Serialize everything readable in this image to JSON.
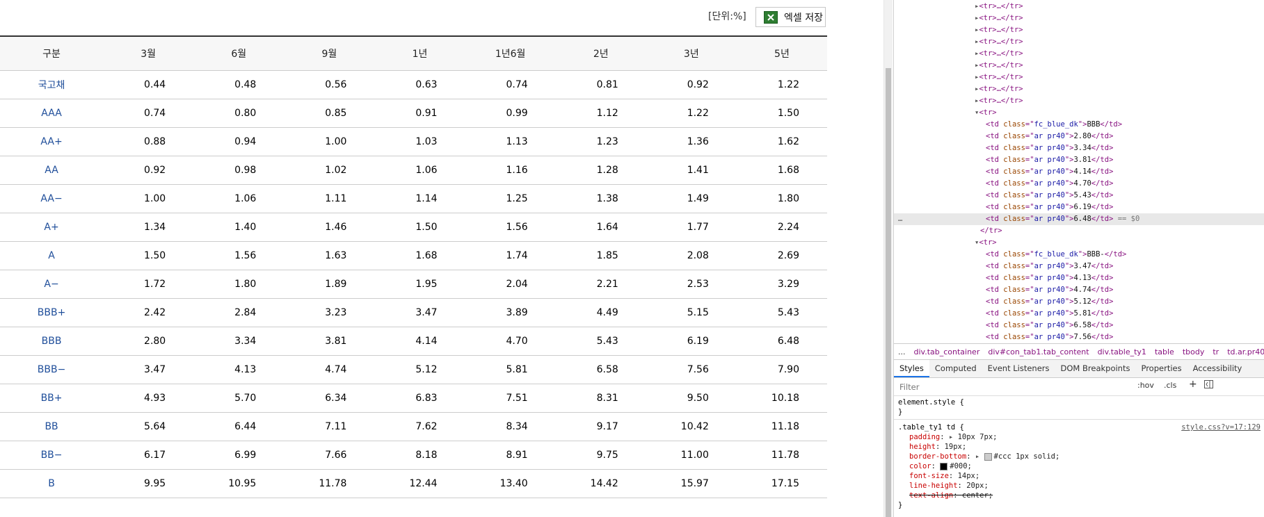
{
  "page": {
    "unit_label": "[단위:%]",
    "excel_button": "엑셀 저장",
    "table": {
      "headers": [
        "구분",
        "3월",
        "6월",
        "9월",
        "1년",
        "1년6월",
        "2년",
        "3년",
        "5년"
      ],
      "rows": [
        {
          "grade": "국고채",
          "values": [
            "0.44",
            "0.48",
            "0.56",
            "0.63",
            "0.74",
            "0.81",
            "0.92",
            "1.22"
          ]
        },
        {
          "grade": "AAA",
          "values": [
            "0.74",
            "0.80",
            "0.85",
            "0.91",
            "0.99",
            "1.12",
            "1.22",
            "1.50"
          ]
        },
        {
          "grade": "AA+",
          "values": [
            "0.88",
            "0.94",
            "1.00",
            "1.03",
            "1.13",
            "1.23",
            "1.36",
            "1.62"
          ]
        },
        {
          "grade": "AA",
          "values": [
            "0.92",
            "0.98",
            "1.02",
            "1.06",
            "1.16",
            "1.28",
            "1.41",
            "1.68"
          ]
        },
        {
          "grade": "AA−",
          "values": [
            "1.00",
            "1.06",
            "1.11",
            "1.14",
            "1.25",
            "1.38",
            "1.49",
            "1.80"
          ]
        },
        {
          "grade": "A+",
          "values": [
            "1.34",
            "1.40",
            "1.46",
            "1.50",
            "1.56",
            "1.64",
            "1.77",
            "2.24"
          ]
        },
        {
          "grade": "A",
          "values": [
            "1.50",
            "1.56",
            "1.63",
            "1.68",
            "1.74",
            "1.85",
            "2.08",
            "2.69"
          ]
        },
        {
          "grade": "A−",
          "values": [
            "1.72",
            "1.80",
            "1.89",
            "1.95",
            "2.04",
            "2.21",
            "2.53",
            "3.29"
          ]
        },
        {
          "grade": "BBB+",
          "values": [
            "2.42",
            "2.84",
            "3.23",
            "3.47",
            "3.89",
            "4.49",
            "5.15",
            "5.43"
          ]
        },
        {
          "grade": "BBB",
          "values": [
            "2.80",
            "3.34",
            "3.81",
            "4.14",
            "4.70",
            "5.43",
            "6.19",
            "6.48"
          ]
        },
        {
          "grade": "BBB−",
          "values": [
            "3.47",
            "4.13",
            "4.74",
            "5.12",
            "5.81",
            "6.58",
            "7.56",
            "7.90"
          ]
        },
        {
          "grade": "BB+",
          "values": [
            "4.93",
            "5.70",
            "6.34",
            "6.83",
            "7.51",
            "8.31",
            "9.50",
            "10.18"
          ]
        },
        {
          "grade": "BB",
          "values": [
            "5.64",
            "6.44",
            "7.11",
            "7.62",
            "8.34",
            "9.17",
            "10.42",
            "11.18"
          ]
        },
        {
          "grade": "BB−",
          "values": [
            "6.17",
            "6.99",
            "7.66",
            "8.18",
            "8.91",
            "9.75",
            "11.00",
            "11.78"
          ]
        },
        {
          "grade": "B",
          "values": [
            "9.95",
            "10.95",
            "11.78",
            "12.44",
            "13.40",
            "14.42",
            "15.97",
            "17.15"
          ]
        }
      ]
    },
    "colors": {
      "grade_text": "#1f4e9a",
      "excel_green": "#2e7d32"
    }
  },
  "devtools": {
    "dom_lines": [
      {
        "indent": 6,
        "kind": "collapsed",
        "text": "<tr>…</tr>"
      },
      {
        "indent": 6,
        "kind": "collapsed",
        "text": "<tr>…</tr>"
      },
      {
        "indent": 6,
        "kind": "collapsed",
        "text": "<tr>…</tr>"
      },
      {
        "indent": 6,
        "kind": "collapsed",
        "text": "<tr>…</tr>"
      },
      {
        "indent": 6,
        "kind": "collapsed",
        "text": "<tr>…</tr>"
      },
      {
        "indent": 6,
        "kind": "collapsed",
        "text": "<tr>…</tr>"
      },
      {
        "indent": 6,
        "kind": "collapsed",
        "text": "<tr>…</tr>"
      },
      {
        "indent": 6,
        "kind": "collapsed",
        "text": "<tr>…</tr>"
      },
      {
        "indent": 6,
        "kind": "collapsed",
        "text": "<tr>…</tr>"
      },
      {
        "indent": 6,
        "kind": "open",
        "text": "<tr>"
      },
      {
        "indent": 7,
        "kind": "td",
        "cls": "fc_blue_dk",
        "val": "BBB"
      },
      {
        "indent": 7,
        "kind": "td",
        "cls": "ar pr40",
        "val": "2.80"
      },
      {
        "indent": 7,
        "kind": "td",
        "cls": "ar pr40",
        "val": "3.34"
      },
      {
        "indent": 7,
        "kind": "td",
        "cls": "ar pr40",
        "val": "3.81"
      },
      {
        "indent": 7,
        "kind": "td",
        "cls": "ar pr40",
        "val": "4.14"
      },
      {
        "indent": 7,
        "kind": "td",
        "cls": "ar pr40",
        "val": "4.70"
      },
      {
        "indent": 7,
        "kind": "td",
        "cls": "ar pr40",
        "val": "5.43"
      },
      {
        "indent": 7,
        "kind": "td",
        "cls": "ar pr40",
        "val": "6.19"
      },
      {
        "indent": 7,
        "kind": "td",
        "cls": "ar pr40",
        "val": "6.48",
        "selected": true,
        "suffix": " == $0"
      },
      {
        "indent": 6,
        "kind": "close",
        "text": "</tr>"
      },
      {
        "indent": 6,
        "kind": "open",
        "text": "<tr>"
      },
      {
        "indent": 7,
        "kind": "td",
        "cls": "fc_blue_dk",
        "val": "BBB-"
      },
      {
        "indent": 7,
        "kind": "td",
        "cls": "ar pr40",
        "val": "3.47"
      },
      {
        "indent": 7,
        "kind": "td",
        "cls": "ar pr40",
        "val": "4.13"
      },
      {
        "indent": 7,
        "kind": "td",
        "cls": "ar pr40",
        "val": "4.74"
      },
      {
        "indent": 7,
        "kind": "td",
        "cls": "ar pr40",
        "val": "5.12"
      },
      {
        "indent": 7,
        "kind": "td",
        "cls": "ar pr40",
        "val": "5.81"
      },
      {
        "indent": 7,
        "kind": "td",
        "cls": "ar pr40",
        "val": "6.58"
      },
      {
        "indent": 7,
        "kind": "td",
        "cls": "ar pr40",
        "val": "7.56"
      }
    ],
    "selected_ellipsis": "…",
    "breadcrumbs": [
      "div.tab_container",
      "div#con_tab1.tab_content",
      "div.table_ty1",
      "table",
      "tbody",
      "tr",
      "td.ar.pr40"
    ],
    "breadcrumb_dots": "...",
    "panel_tabs": [
      "Styles",
      "Computed",
      "Event Listeners",
      "DOM Breakpoints",
      "Properties",
      "Accessibility"
    ],
    "filter_placeholder": "Filter",
    "filter_tools": [
      ":hov",
      ".cls",
      "+"
    ],
    "styles": {
      "element_style": "element.style {",
      "close_brace": "}",
      "rule_selector": ".table_ty1 td {",
      "rule_source": "style.css?v=17:129",
      "props": [
        {
          "name": "padding",
          "value": "10px 7px;",
          "expand": true
        },
        {
          "name": "height",
          "value": "19px;"
        },
        {
          "name": "border-bottom",
          "value": "#ccc 1px solid;",
          "expand": true,
          "swatch": "#cccccc"
        },
        {
          "name": "color",
          "value": "#000;",
          "swatch": "#000000"
        },
        {
          "name": "font-size",
          "value": "14px;"
        },
        {
          "name": "line-height",
          "value": "20px;"
        },
        {
          "name": "text-align",
          "value": "center;",
          "struck": true
        }
      ]
    }
  }
}
